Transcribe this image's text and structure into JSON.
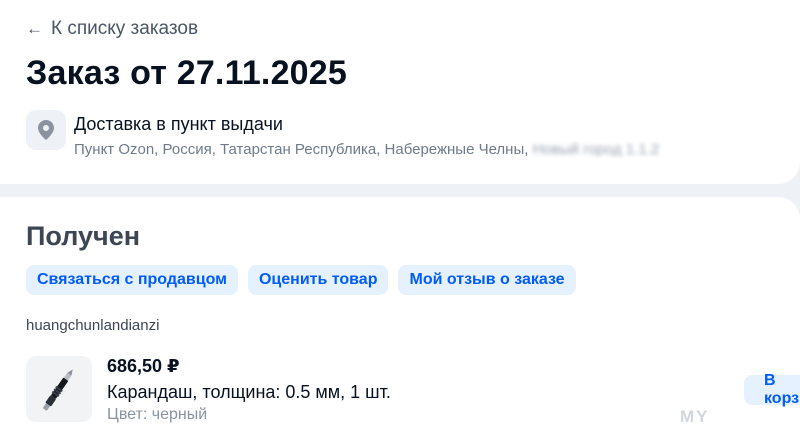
{
  "header": {
    "back_label": "К списку заказов",
    "order_title": "Заказ от 27.11.2025"
  },
  "delivery": {
    "type": "Доставка в пункт выдачи",
    "address": "Пункт Ozon, Россия, Татарстан Республика, Набережные Челны,",
    "address_hidden": "Новый город 1.1.2"
  },
  "order": {
    "status": "Получен",
    "actions": [
      {
        "label": "Связаться с продавцом"
      },
      {
        "label": "Оценить товар"
      },
      {
        "label": "Мой отзыв о заказе"
      }
    ],
    "seller": "huangchunlandianzi",
    "item": {
      "price": "686,50 ₽",
      "name": "Карандаш, толщина: 0.5 мм, 1 шт.",
      "color": "Цвет: черный",
      "cart_label": "В корзину"
    }
  },
  "watermark": "MY",
  "colors": {
    "accent": "#005bff",
    "accent_bg": "#e6f1ff",
    "page_bg": "#eef1f6"
  }
}
